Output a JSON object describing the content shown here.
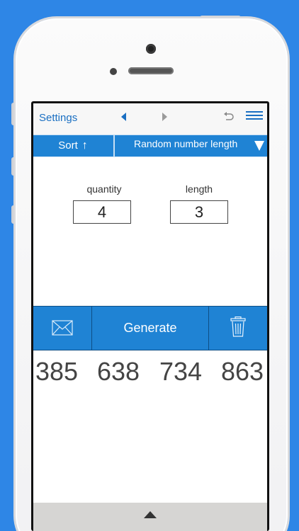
{
  "navbar": {
    "settings_label": "Settings",
    "prev_icon": "triangle-left-icon",
    "next_icon": "triangle-right-icon",
    "undo_icon": "undo-icon",
    "menu_icon": "menu-icon"
  },
  "toolbar": {
    "sort_label": "Sort",
    "sort_arrow": "↑",
    "mode_label": "Random number length",
    "mode_caret_icon": "triangle-down-icon"
  },
  "fields": {
    "quantity": {
      "label": "quantity",
      "value": "4"
    },
    "length": {
      "label": "length",
      "value": "3"
    }
  },
  "actions": {
    "mail_icon": "envelope-icon",
    "generate_label": "Generate",
    "trash_icon": "trash-icon"
  },
  "results": [
    "385",
    "638",
    "734",
    "863"
  ],
  "bottom": {
    "handle_icon": "triangle-up-icon"
  },
  "colors": {
    "background": "#2e86e6",
    "accent": "#1f83d4",
    "link": "#1a6fc2"
  }
}
